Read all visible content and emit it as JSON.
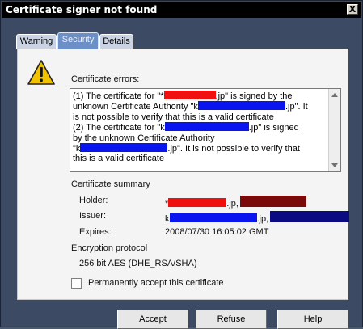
{
  "window": {
    "title": "Certificate signer not found",
    "close_glyph": "X"
  },
  "tabs": [
    {
      "label": "Warning",
      "active": false
    },
    {
      "label": "Security",
      "active": true
    },
    {
      "label": "Details",
      "active": false
    }
  ],
  "errors": {
    "heading": "Certificate errors:",
    "lines": {
      "l1a": "(1) The certificate for \"*",
      "l1b": ".jp\" is signed by the",
      "l2a": "unknown Certificate Authority \"k",
      "l2b": ".jp\". It",
      "l3": "is not possible to verify that this is a valid certificate",
      "l4a": "(2) The certificate for \"k",
      "l4b": ".jp\" is signed",
      "l5": "by the unknown Certificate Authority",
      "l6a": "\"k",
      "l6b": ".jp\". It is not possible to verify that",
      "l7": "this is a valid certificate"
    }
  },
  "summary": {
    "heading": "Certificate summary",
    "holder_label": "Holder:",
    "holder_prefix": "*",
    "holder_mid": ".jp,",
    "issuer_label": "Issuer:",
    "issuer_prefix": "k",
    "issuer_mid": ".jp,",
    "expires_label": "Expires:",
    "expires_value": "2008/07/30 16:05:02 GMT"
  },
  "encryption": {
    "heading": "Encryption protocol",
    "value": "256 bit AES (DHE_RSA/SHA)"
  },
  "accept_checkbox": {
    "label": "Permanently accept this certificate",
    "checked": false
  },
  "buttons": {
    "accept": "Accept",
    "refuse": "Refuse",
    "help": "Help"
  },
  "colors": {
    "redaction_red": "#f01010",
    "redaction_blue": "#0a14ee",
    "redaction_maroon": "#7a0a0a",
    "redaction_navy": "#0a0a82"
  }
}
